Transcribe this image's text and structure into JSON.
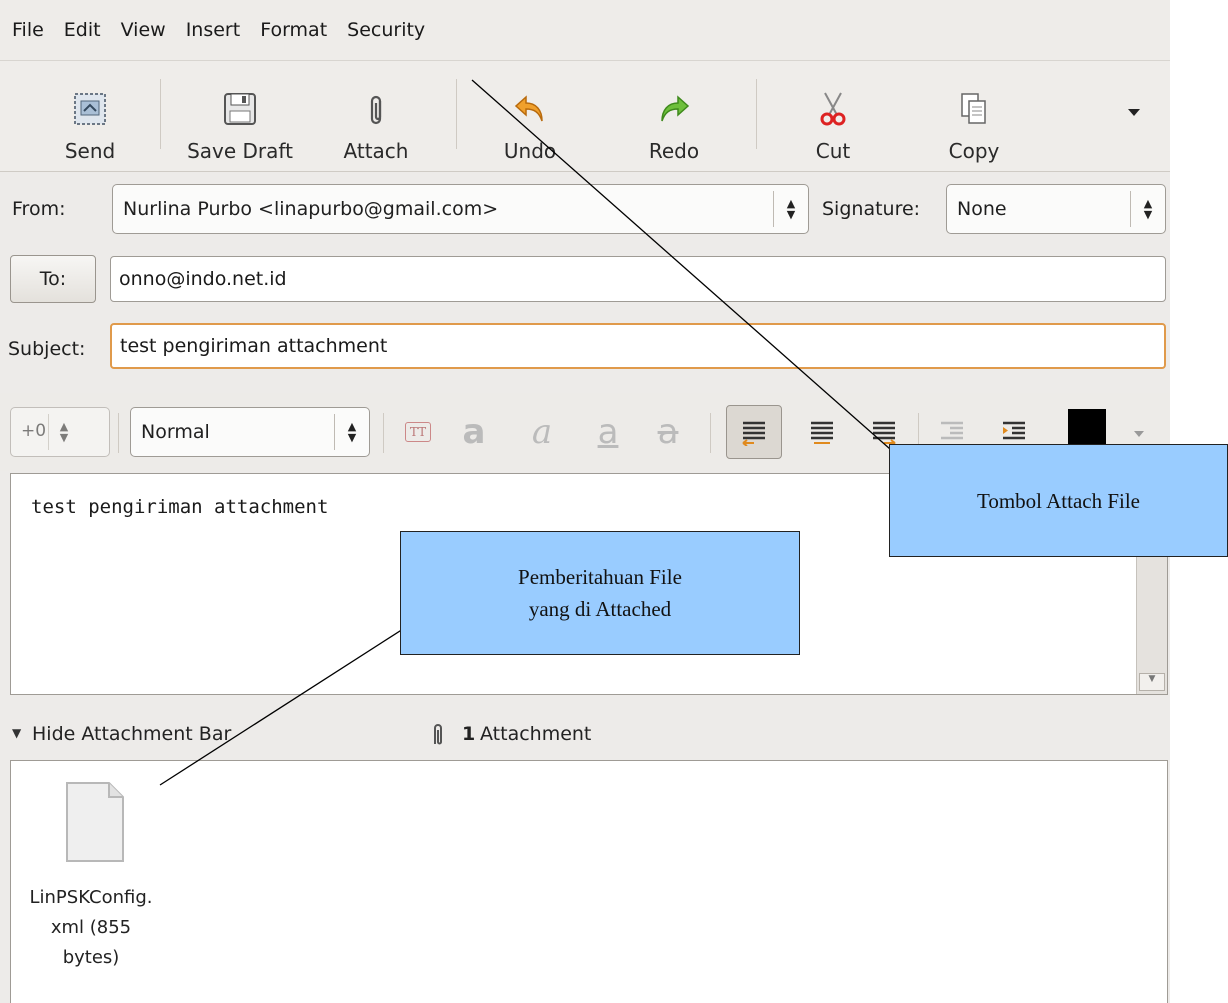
{
  "menu": [
    "File",
    "Edit",
    "View",
    "Insert",
    "Format",
    "Security"
  ],
  "toolbar": {
    "send": "Send",
    "save_draft": "Save Draft",
    "attach": "Attach",
    "undo": "Undo",
    "redo": "Redo",
    "cut": "Cut",
    "copy": "Copy"
  },
  "header": {
    "from_label": "From:",
    "from_value": "Nurlina Purbo <linapurbo@gmail.com>",
    "signature_label": "Signature:",
    "signature_value": "None",
    "to_label": "To:",
    "to_value": "onno@indo.net.id",
    "subject_label": "Subject:",
    "subject_value": "test pengiriman attachment"
  },
  "format": {
    "size_value": "+0",
    "style_value": "Normal",
    "tt_label": "TT",
    "bold_glyph": "a",
    "italic_glyph": "a",
    "underline_glyph": "a",
    "strike_glyph": "a",
    "text_color": "#000000"
  },
  "body": {
    "text": "test pengiriman attachment"
  },
  "attachments": {
    "toggle_label": "Hide Attachment Bar",
    "count": "1",
    "count_label": "Attachment",
    "file_line1": "LinPSKConfig.",
    "file_line2": "xml (855",
    "file_line3": "bytes)"
  },
  "callouts": {
    "attach_button": "Tombol Attach File",
    "attached_notice_line1": "Pemberitahuan File",
    "attached_notice_line2": "yang di Attached"
  }
}
